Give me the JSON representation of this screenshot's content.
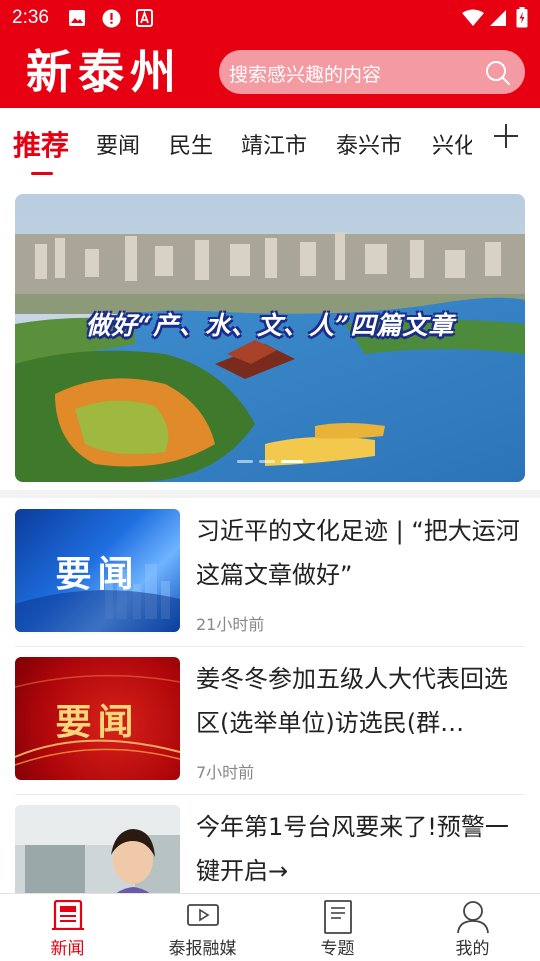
{
  "status_bar": {
    "time": "2:36"
  },
  "header": {
    "logo": "新泰州",
    "search_placeholder": "搜索感兴趣的内容"
  },
  "tabs": [
    {
      "label": "推荐",
      "active": true
    },
    {
      "label": "要闻"
    },
    {
      "label": "民生"
    },
    {
      "label": "靖江市"
    },
    {
      "label": "泰兴市"
    },
    {
      "label": "兴化"
    }
  ],
  "banner": {
    "title": "做好“产、水、文、人”四篇文章",
    "page_count": 3,
    "current_page": 3
  },
  "news": [
    {
      "thumb_text": "要闻",
      "title": "习近平的文化足迹 | “把大运河这篇文章做好”",
      "time": "21小时前"
    },
    {
      "thumb_text": "要闻",
      "title": "姜冬冬参加五级人大代表回选区(选举单位)访选民(群…",
      "time": "7小时前"
    },
    {
      "thumb_text": "",
      "title": "今年第1号台风要来了!预警一键开启→",
      "time": ""
    }
  ],
  "bottom_nav": [
    {
      "label": "新闻",
      "icon": "newspaper-icon",
      "active": true
    },
    {
      "label": "泰报融媒",
      "icon": "video-icon"
    },
    {
      "label": "专题",
      "icon": "document-icon"
    },
    {
      "label": "我的",
      "icon": "user-icon"
    }
  ],
  "colors": {
    "brand": "#e60012",
    "search_bg": "#f49aa2"
  }
}
